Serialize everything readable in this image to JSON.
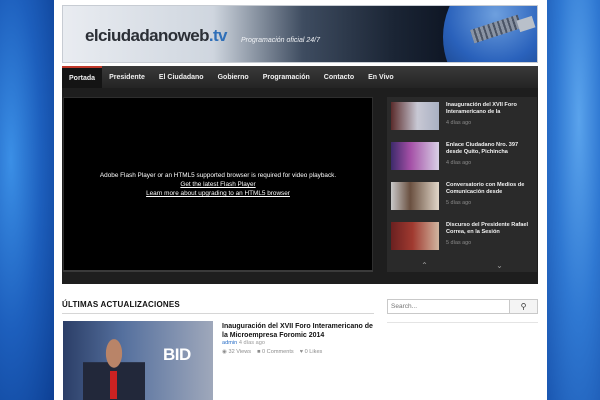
{
  "site": {
    "logo_main": "elciudadanoweb",
    "logo_suffix": ".tv",
    "tagline": "Programación oficial 24/7"
  },
  "nav": {
    "items": [
      {
        "label": "Portada",
        "active": true
      },
      {
        "label": "Presidente",
        "active": false
      },
      {
        "label": "El Ciudadano",
        "active": false
      },
      {
        "label": "Gobierno",
        "active": false
      },
      {
        "label": "Programación",
        "active": false
      },
      {
        "label": "Contacto",
        "active": false
      },
      {
        "label": "En Vivo",
        "active": false
      }
    ]
  },
  "player": {
    "message": "Adobe Flash Player or an HTML5 supported browser is required for video playback.",
    "link_flash": "Get the latest Flash Player",
    "link_html5": "Learn more about upgrading to an HTML5 browser"
  },
  "playlist": {
    "items": [
      {
        "title": "Inauguración del XVII Foro Interamericano de la",
        "time": "4 días ago"
      },
      {
        "title": "Enlace Ciudadano Nro. 397 desde Quito, Pichincha",
        "time": "4 días ago"
      },
      {
        "title": "Conversatorio con Medios de Comunicación desde",
        "time": "5 días ago"
      },
      {
        "title": "Discurso del Presidente Rafael Correa, en la Sesión",
        "time": "5 días ago"
      }
    ],
    "up_icon": "chevron-up-icon",
    "down_icon": "chevron-down-icon"
  },
  "latest": {
    "heading": "ÚLTIMAS ACTUALIZACIONES",
    "post": {
      "title": "Inauguración del XVII Foro Interamericano de la Microempresa Foromic 2014",
      "thumb_text": "BID",
      "author": "admin",
      "date": "4 días ago",
      "views": "32 Views",
      "comments": "0 Comments",
      "likes": "0 Likes"
    }
  },
  "search": {
    "placeholder": "Search..."
  },
  "colors": {
    "nav_active_accent": "#c0392b",
    "link": "#2a6fc7"
  }
}
